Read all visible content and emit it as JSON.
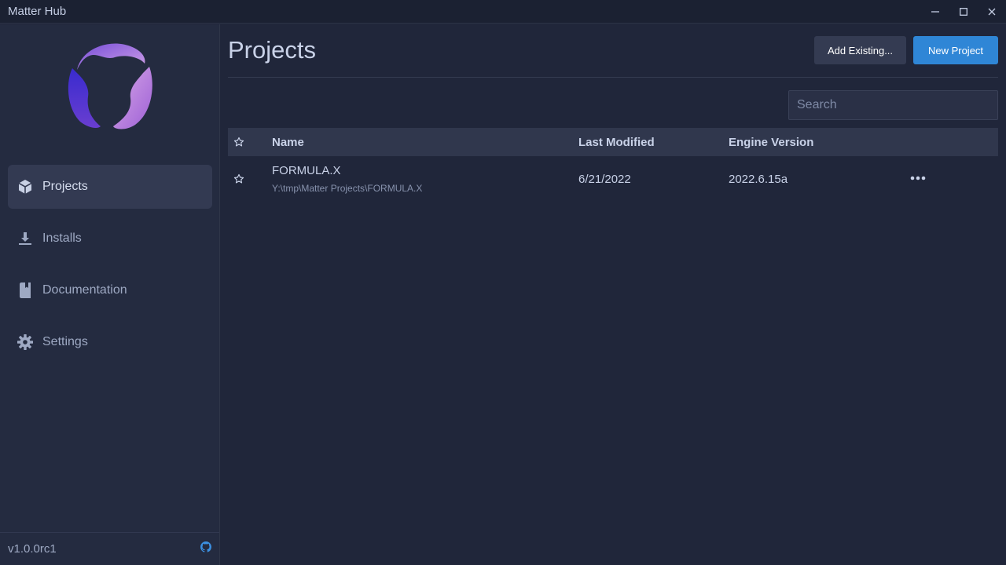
{
  "window": {
    "title": "Matter Hub"
  },
  "sidebar": {
    "items": [
      {
        "label": "Projects",
        "icon": "cube-icon",
        "active": true
      },
      {
        "label": "Installs",
        "icon": "download-icon",
        "active": false
      },
      {
        "label": "Documentation",
        "icon": "book-icon",
        "active": false
      },
      {
        "label": "Settings",
        "icon": "gear-icon",
        "active": false
      }
    ],
    "version": "v1.0.0rc1",
    "footer_icon": "github-icon"
  },
  "main": {
    "title": "Projects",
    "add_existing_label": "Add Existing...",
    "new_project_label": "New Project",
    "search": {
      "placeholder": "Search",
      "value": ""
    },
    "table": {
      "columns": {
        "name": "Name",
        "last_modified": "Last Modified",
        "engine_version": "Engine Version"
      },
      "rows": [
        {
          "name": "FORMULA.X",
          "path": "Y:\\tmp\\Matter Projects\\FORMULA.X",
          "last_modified": "6/21/2022",
          "engine_version": "2022.6.15a"
        }
      ]
    }
  },
  "colors": {
    "accent": "#2f86d6",
    "background": "#20263a",
    "sidebar": "#242b40"
  }
}
